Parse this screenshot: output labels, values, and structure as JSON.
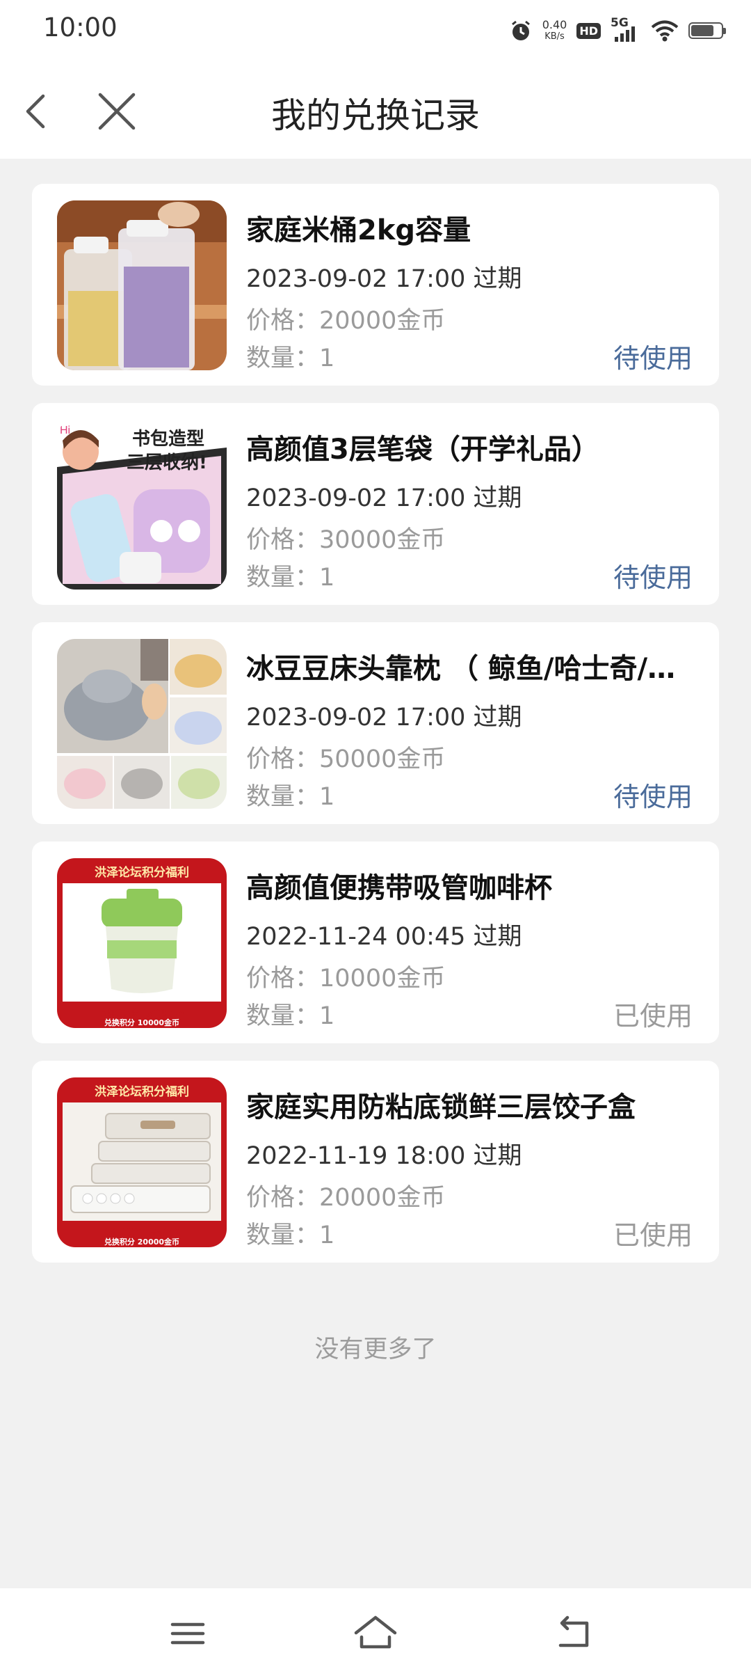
{
  "status_bar": {
    "time": "10:00",
    "speed_value": "0.40",
    "speed_unit": "KB/s",
    "hd": "HD",
    "network": "5G",
    "battery_level": 0.75,
    "icons": [
      "alarm-icon",
      "signal-icon",
      "wifi-icon",
      "battery-icon"
    ]
  },
  "header": {
    "title": "我的兑换记录",
    "icons": [
      "back-icon",
      "close-icon"
    ]
  },
  "labels": {
    "price": "价格：",
    "quantity": "数量："
  },
  "records": [
    {
      "title": "家庭米桶2kg容量",
      "expiry": "2023-09-02 17:00 过期",
      "price": "20000金币",
      "quantity": "1",
      "status": "待使用",
      "status_color": "#4a6b9a",
      "image": "rice-bucket"
    },
    {
      "title": "高颜值3层笔袋（开学礼品）",
      "expiry": "2023-09-02 17:00 过期",
      "price": "30000金币",
      "quantity": "1",
      "status": "待使用",
      "status_color": "#4a6b9a",
      "image": "pencil-case",
      "image_text": [
        "书包造型",
        "三层收纳!",
        "Hi"
      ]
    },
    {
      "title": "冰豆豆床头靠枕 （ 鲸鱼/哈士奇/…",
      "expiry": "2023-09-02 17:00 过期",
      "price": "50000金币",
      "quantity": "1",
      "status": "待使用",
      "status_color": "#4a6b9a",
      "image": "pillow"
    },
    {
      "title": "高颜值便携带吸管咖啡杯",
      "expiry": "2022-11-24 00:45 过期",
      "price": "10000金币",
      "quantity": "1",
      "status": "已使用",
      "status_color": "#9a9a9a",
      "image": "coffee-cup",
      "image_text": [
        "洪泽论坛积分福利",
        "高颜值便携带吸管咖啡杯",
        "兑换积分  10000金币"
      ]
    },
    {
      "title": "家庭实用防粘底锁鲜三层饺子盒",
      "expiry": "2022-11-19 18:00 过期",
      "price": "20000金币",
      "quantity": "1",
      "status": "已使用",
      "status_color": "#9a9a9a",
      "image": "dumpling-box",
      "image_text": [
        "洪泽论坛积分福利",
        "防粘底锁鲜三层饺子盒",
        "兑换积分  20000金币"
      ]
    }
  ],
  "footer_text": "没有更多了",
  "bottom_nav": {
    "icons": [
      "menu-icon",
      "home-icon",
      "back-nav-icon"
    ]
  }
}
